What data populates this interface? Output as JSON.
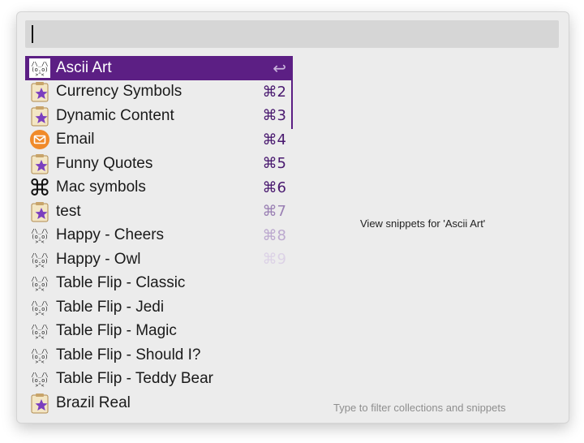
{
  "search": {
    "value": ""
  },
  "items": [
    {
      "label": "Ascii Art",
      "shortcut": "↩",
      "icon": "ascii-cat-icon",
      "selected": true
    },
    {
      "label": "Currency Symbols",
      "shortcut": "⌘2",
      "icon": "clipboard-star-icon"
    },
    {
      "label": "Dynamic Content",
      "shortcut": "⌘3",
      "icon": "clipboard-star-icon"
    },
    {
      "label": "Email",
      "shortcut": "⌘4",
      "icon": "email-icon"
    },
    {
      "label": "Funny Quotes",
      "shortcut": "⌘5",
      "icon": "clipboard-star-icon"
    },
    {
      "label": "Mac symbols",
      "shortcut": "⌘6",
      "icon": "command-key-icon"
    },
    {
      "label": "test",
      "shortcut": "⌘7",
      "icon": "clipboard-star-icon"
    },
    {
      "label": "Happy - Cheers",
      "shortcut": "⌘8",
      "icon": "ascii-cat-icon"
    },
    {
      "label": "Happy - Owl",
      "shortcut": "⌘9",
      "icon": "ascii-cat-icon"
    },
    {
      "label": "Table Flip - Classic",
      "shortcut": "",
      "icon": "ascii-cat-icon"
    },
    {
      "label": "Table Flip - Jedi",
      "shortcut": "",
      "icon": "ascii-cat-icon"
    },
    {
      "label": "Table Flip - Magic",
      "shortcut": "",
      "icon": "ascii-cat-icon"
    },
    {
      "label": "Table Flip - Should I?",
      "shortcut": "",
      "icon": "ascii-cat-icon"
    },
    {
      "label": "Table Flip - Teddy Bear",
      "shortcut": "",
      "icon": "ascii-cat-icon"
    },
    {
      "label": "Brazil Real",
      "shortcut": "",
      "icon": "clipboard-star-icon"
    }
  ],
  "preview": {
    "text": "View snippets for 'Ascii Art'"
  },
  "footer": {
    "hint": "Type to filter collections and snippets"
  },
  "colors": {
    "selection": "#5c1f84",
    "shortcut": "#4a1a70",
    "window_bg": "#ececec"
  }
}
